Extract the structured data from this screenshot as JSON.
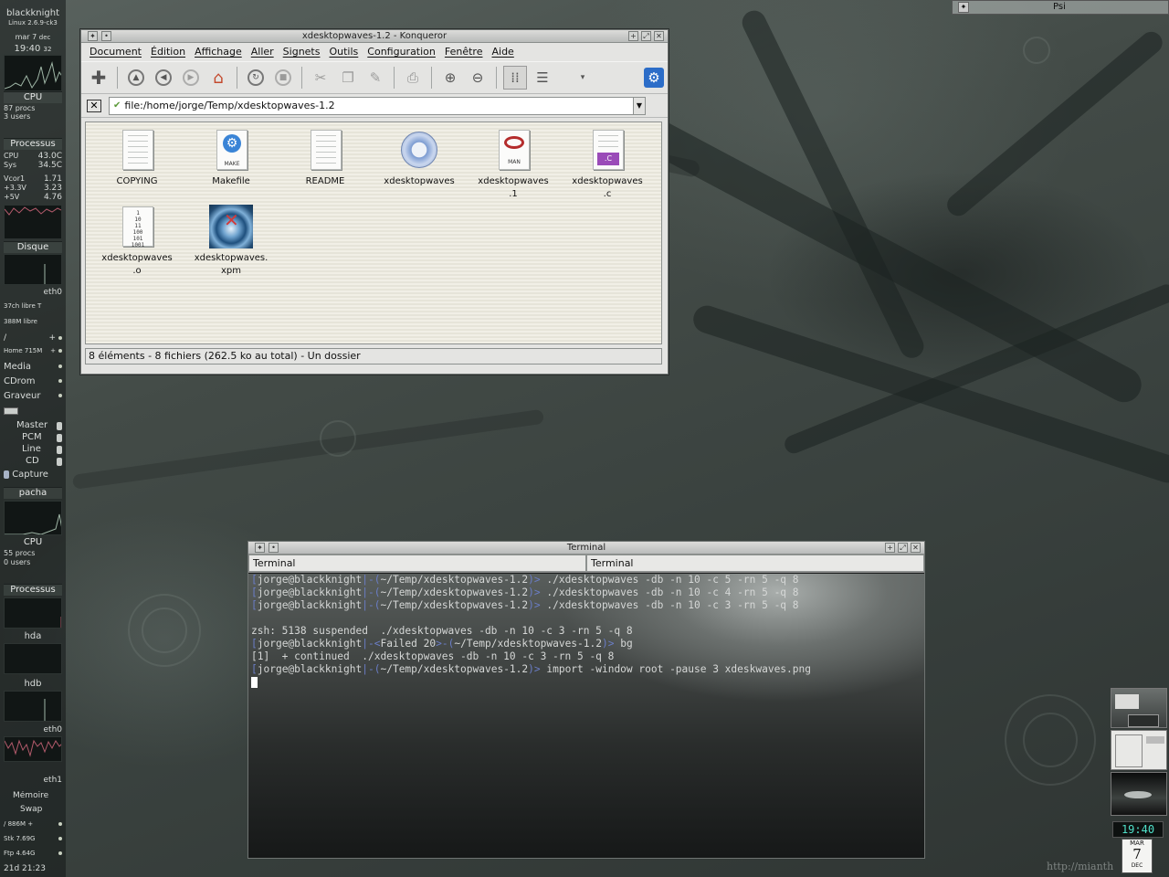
{
  "desktop": {
    "watermark": "http://mianth",
    "psi_label": "Psi",
    "clock": {
      "time": "19:40",
      "weekday": "MAR",
      "day": "7",
      "month": "DEC"
    }
  },
  "gkrellm": {
    "host": "blackknight",
    "kernel": "Linux 2.6.9-ck3",
    "date": "mar 7",
    "date_month": "dec",
    "time": "19:40",
    "time_sec": "32",
    "cpu1": {
      "label": "CPU",
      "procs": "87 procs",
      "users": "3 users"
    },
    "sensors": {
      "label": "Processus",
      "cpu_name": "CPU",
      "cpu_temp": "43.0C",
      "sys_name": "Sys",
      "sys_temp": "34.5C",
      "vcore_name": "Vcor1",
      "vcore": "1.71",
      "v33_name": "+3.3V",
      "v33": "3.23",
      "v5_name": "+5V",
      "v5": "4.76"
    },
    "disk_label": "Disque",
    "eth0_label": "eth0",
    "fs": [
      {
        "name": "37ch libre",
        "mark": "T"
      },
      {
        "name": "388M libre",
        "mark": ""
      },
      {
        "name": "/",
        "mark": ""
      },
      {
        "name": "Home 715M",
        "mark": ""
      }
    ],
    "mounts": [
      "Media",
      "CDrom",
      "Graveur"
    ],
    "mixer": [
      "Master",
      "PCM",
      "Line",
      "CD"
    ],
    "capture": "Capture",
    "pacha": "pacha",
    "cpu2": {
      "label": "CPU",
      "procs": "55 procs",
      "users": "0 users"
    },
    "proc2": "Processus",
    "hda": "hda",
    "hdb": "hdb",
    "eth0b": "eth0",
    "eth1": "eth1",
    "mem": {
      "label": "Mémoire",
      "swap": "Swap"
    },
    "fs2": [
      {
        "name": "/ 886M",
        "mark": "+"
      },
      {
        "name": "Stk 7.69G",
        "mark": ""
      },
      {
        "name": "Ftp 4.64G",
        "mark": ""
      }
    ],
    "uptime": "21d 21:23"
  },
  "konqueror": {
    "title": "xdesktopwaves-1.2 - Konqueror",
    "menu": [
      "Document",
      "Édition",
      "Affichage",
      "Aller",
      "Signets",
      "Outils",
      "Configuration",
      "Fenêtre",
      "Aide"
    ],
    "location": "file:/home/jorge/Temp/xdesktopwaves-1.2",
    "files": [
      {
        "name": "COPYING",
        "icon": "text-doc-icon"
      },
      {
        "name": "Makefile",
        "icon": "makefile-icon"
      },
      {
        "name": "README",
        "icon": "text-doc-icon"
      },
      {
        "name": "xdesktopwaves",
        "icon": "executable-gear-icon"
      },
      {
        "name": "xdesktopwaves\n.1",
        "icon": "man-page-icon"
      },
      {
        "name": "xdesktopwaves\n.c",
        "icon": "c-source-icon"
      },
      {
        "name": "xdesktopwaves\n.o",
        "icon": "binary-object-icon"
      },
      {
        "name": "xdesktopwaves.\nxpm",
        "icon": "image-preview-icon"
      }
    ],
    "status": "8 éléments - 8 fichiers (262.5 ko au total) - Un dossier"
  },
  "terminal": {
    "title": "Terminal",
    "tabs": [
      "Terminal",
      "Terminal"
    ],
    "lines": [
      {
        "user": "jorge@blackknight",
        "sep1": "|-(",
        "path": "~/Temp/xdesktopwaves-1.2",
        "sep2": ")> ",
        "cmd": "./xdesktopwaves -db -n 10 -c 5 -rn 5 -q 8"
      },
      {
        "user": "jorge@blackknight",
        "sep1": "|-(",
        "path": "~/Temp/xdesktopwaves-1.2",
        "sep2": ")> ",
        "cmd": "./xdesktopwaves -db -n 10 -c 4 -rn 5 -q 8"
      },
      {
        "user": "jorge@blackknight",
        "sep1": "|-(",
        "path": "~/Temp/xdesktopwaves-1.2",
        "sep2": ")> ",
        "cmd": "./xdesktopwaves -db -n 10 -c 3 -rn 5 -q 8"
      },
      {
        "plain": ""
      },
      {
        "plain": "zsh: 5138 suspended  ./xdesktopwaves -db -n 10 -c 3 -rn 5 -q 8"
      },
      {
        "user": "jorge@blackknight",
        "sep1": "|-<",
        "path": "Failed 20",
        "sep2": ">-(",
        "path2": "~/Temp/xdesktopwaves-1.2",
        "sep3": ")> ",
        "cmd": "bg"
      },
      {
        "plain": "[1]  + continued  ./xdesktopwaves -db -n 10 -c 3 -rn 5 -q 8"
      },
      {
        "user": "jorge@blackknight",
        "sep1": "|-(",
        "path": "~/Temp/xdesktopwaves-1.2",
        "sep2": ")> ",
        "cmd": "import -window root -pause 3 xdeskwaves.png"
      }
    ]
  }
}
